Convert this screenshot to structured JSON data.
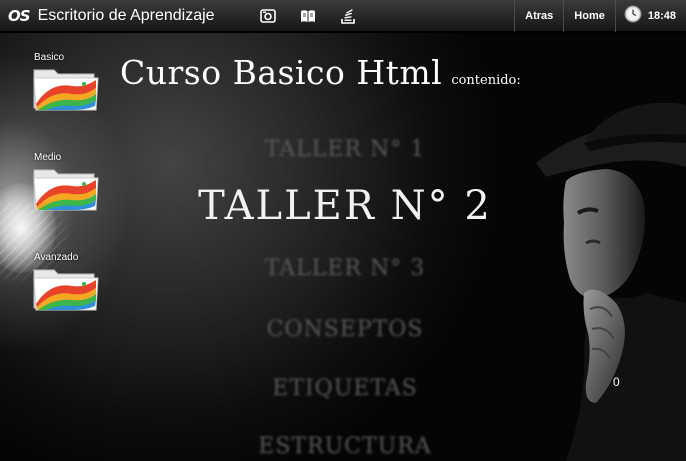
{
  "topbar": {
    "logo": "OS",
    "title": "Escritorio de Aprendizaje",
    "icons": [
      "camera-icon",
      "book-icon",
      "stack-icon"
    ],
    "nav": {
      "back": "Atras",
      "home": "Home"
    },
    "time": "18:48"
  },
  "desktop": {
    "folders": [
      {
        "label": "Basico"
      },
      {
        "label": "Medio"
      },
      {
        "label": "Avanzado"
      }
    ],
    "heading": {
      "title": "Curso Basico Html",
      "subtitle": "contenido:"
    },
    "menu": [
      "TALLER N° 1",
      "TALLER N° 2",
      "TALLER N° 3",
      "CONSEPTOS",
      "ETIQUETAS",
      "ESTRUCTURA"
    ],
    "active_index": 1,
    "counter": "0"
  },
  "colors": {
    "topbar": "#2a2a2a",
    "background": "#000000",
    "active_text": "#f2f2f2",
    "inactive_text": "#5a5a5a"
  }
}
